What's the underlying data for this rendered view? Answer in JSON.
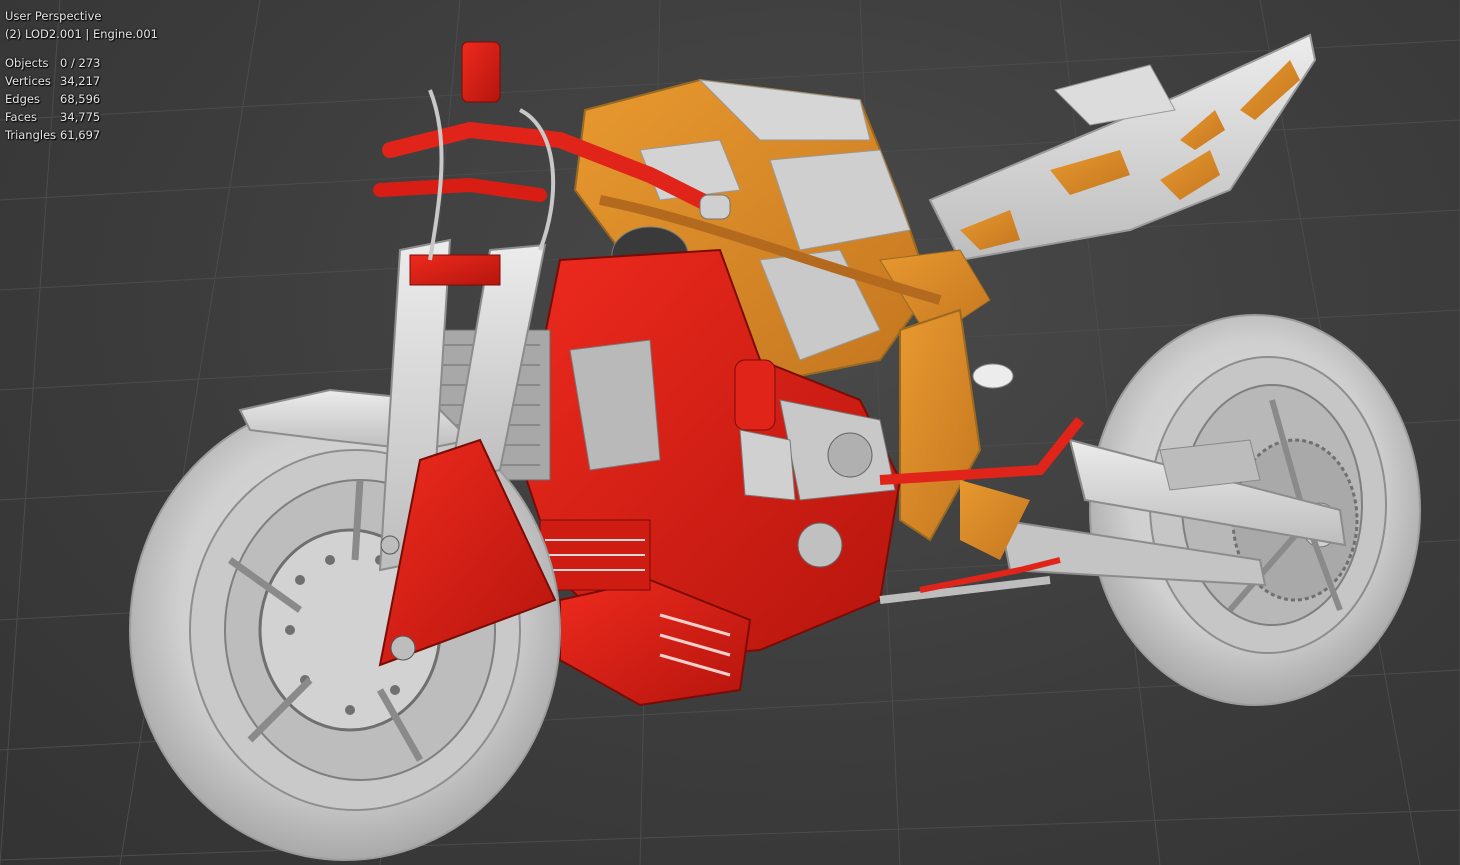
{
  "viewport": {
    "view_name": "User Perspective",
    "active_object": "(2) LOD2.001 | Engine.001"
  },
  "statistics": [
    {
      "label": "Objects",
      "value": "0 / 273"
    },
    {
      "label": "Vertices",
      "value": "34,217"
    },
    {
      "label": "Edges",
      "value": "68,596"
    },
    {
      "label": "Faces",
      "value": "34,775"
    },
    {
      "label": "Triangles",
      "value": "61,697"
    }
  ],
  "colors": {
    "background": "#3d3d3d",
    "grid": "#4a4a4a",
    "model_white": "#d8d8d8",
    "model_red": "#d81e14",
    "model_orange": "#d9882a"
  }
}
